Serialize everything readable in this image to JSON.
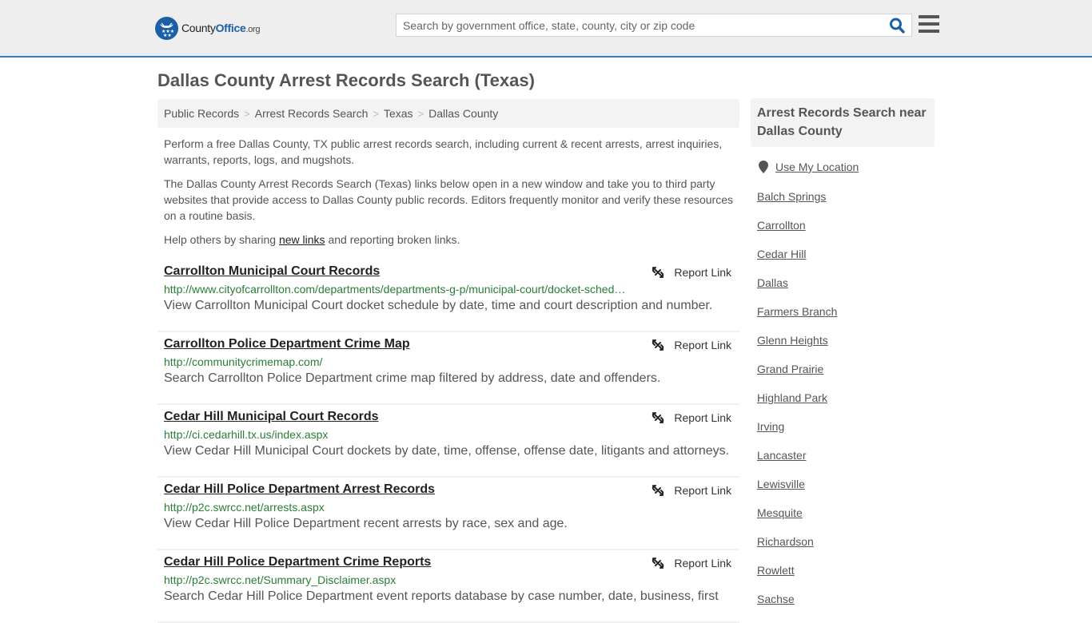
{
  "header": {
    "logo": {
      "part1": "County",
      "part2": "Office",
      "part3": ".org"
    },
    "search_placeholder": "Search by government office, state, county, city or zip code",
    "search_value": "",
    "brand_color": "#1b5fa8",
    "accent_border": "#3a7cab"
  },
  "page_title": "Dallas County Arrest Records Search (Texas)",
  "breadcrumb": [
    "Public Records",
    "Arrest Records Search",
    "Texas",
    "Dallas County"
  ],
  "intro": {
    "p1": "Perform a free Dallas County, TX public arrest records search, including current & recent arrests, arrest inquiries, warrants, reports, logs, and mugshots.",
    "p2": "The Dallas County Arrest Records Search (Texas) links below open in a new window and take you to third party websites that provide access to Dallas County public records. Editors frequently monitor and verify these resources on a routine basis.",
    "p3_before": "Help others by sharing ",
    "p3_link": "new links",
    "p3_after": " and reporting broken links."
  },
  "report_label": "Report Link",
  "results": [
    {
      "title": "Carrollton Municipal Court Records",
      "url": "http://www.cityofcarrollton.com/departments/departments-g-p/municipal-court/docket-sched…",
      "desc": "View Carrollton Municipal Court docket schedule by date, time and court description and number."
    },
    {
      "title": "Carrollton Police Department Crime Map",
      "url": "http://communitycrimemap.com/",
      "desc": "Search Carrollton Police Department crime map filtered by address, date and offenders."
    },
    {
      "title": "Cedar Hill Municipal Court Records",
      "url": "http://ci.cedarhill.tx.us/index.aspx",
      "desc": "View Cedar Hill Municipal Court dockets by date, time, offense, offense date, litigants and attorneys."
    },
    {
      "title": "Cedar Hill Police Department Arrest Records",
      "url": "http://p2c.swrcc.net/arrests.aspx",
      "desc": "View Cedar Hill Police Department recent arrests by race, sex and age."
    },
    {
      "title": "Cedar Hill Police Department Crime Reports",
      "url": "http://p2c.swrcc.net/Summary_Disclaimer.aspx",
      "desc": "Search Cedar Hill Police Department event reports database by case number, date, business, first"
    }
  ],
  "sidebar": {
    "heading": "Arrest Records Search near Dallas County",
    "use_location": "Use My Location",
    "cities": [
      "Balch Springs",
      "Carrollton",
      "Cedar Hill",
      "Dallas",
      "Farmers Branch",
      "Glenn Heights",
      "Grand Prairie",
      "Highland Park",
      "Irving",
      "Lancaster",
      "Lewisville",
      "Mesquite",
      "Richardson",
      "Rowlett",
      "Sachse"
    ]
  }
}
